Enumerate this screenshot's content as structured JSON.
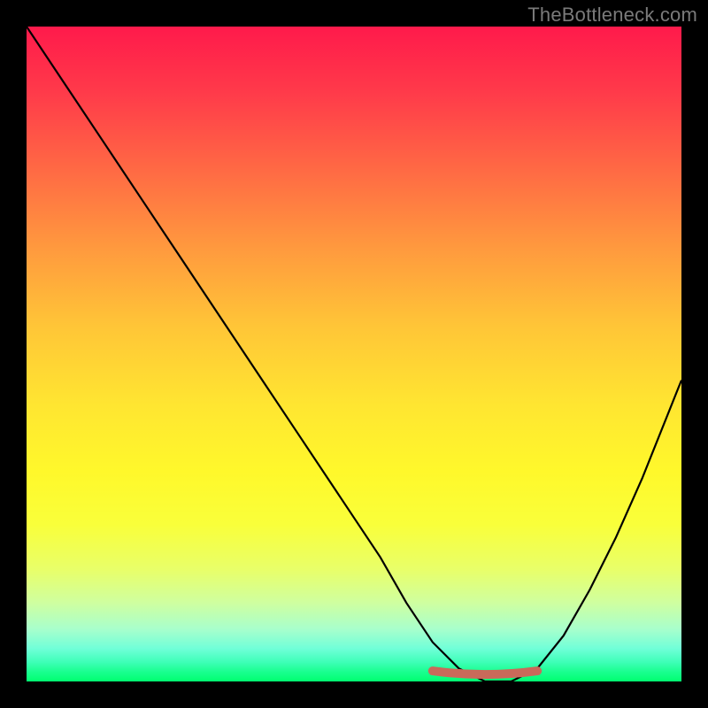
{
  "watermark": "TheBottleneck.com",
  "chart_data": {
    "type": "line",
    "title": "",
    "xlabel": "",
    "ylabel": "",
    "xlim": [
      0,
      100
    ],
    "ylim": [
      0,
      100
    ],
    "grid": false,
    "legend": false,
    "background_gradient": {
      "top": "#ff1a4b",
      "mid": "#ffe631",
      "bottom": "#00ff70"
    },
    "series": [
      {
        "name": "bottleneck-curve",
        "x": [
          0,
          6,
          12,
          18,
          24,
          30,
          36,
          42,
          48,
          54,
          58,
          62,
          66,
          70,
          74,
          78,
          82,
          86,
          90,
          94,
          98,
          100
        ],
        "values": [
          100,
          91,
          82,
          73,
          64,
          55,
          46,
          37,
          28,
          19,
          12,
          6,
          2,
          0,
          0,
          2,
          7,
          14,
          22,
          31,
          41,
          46
        ]
      }
    ],
    "optimal_range": {
      "x_start": 62,
      "x_end": 78,
      "color": "#c96a5a"
    }
  }
}
